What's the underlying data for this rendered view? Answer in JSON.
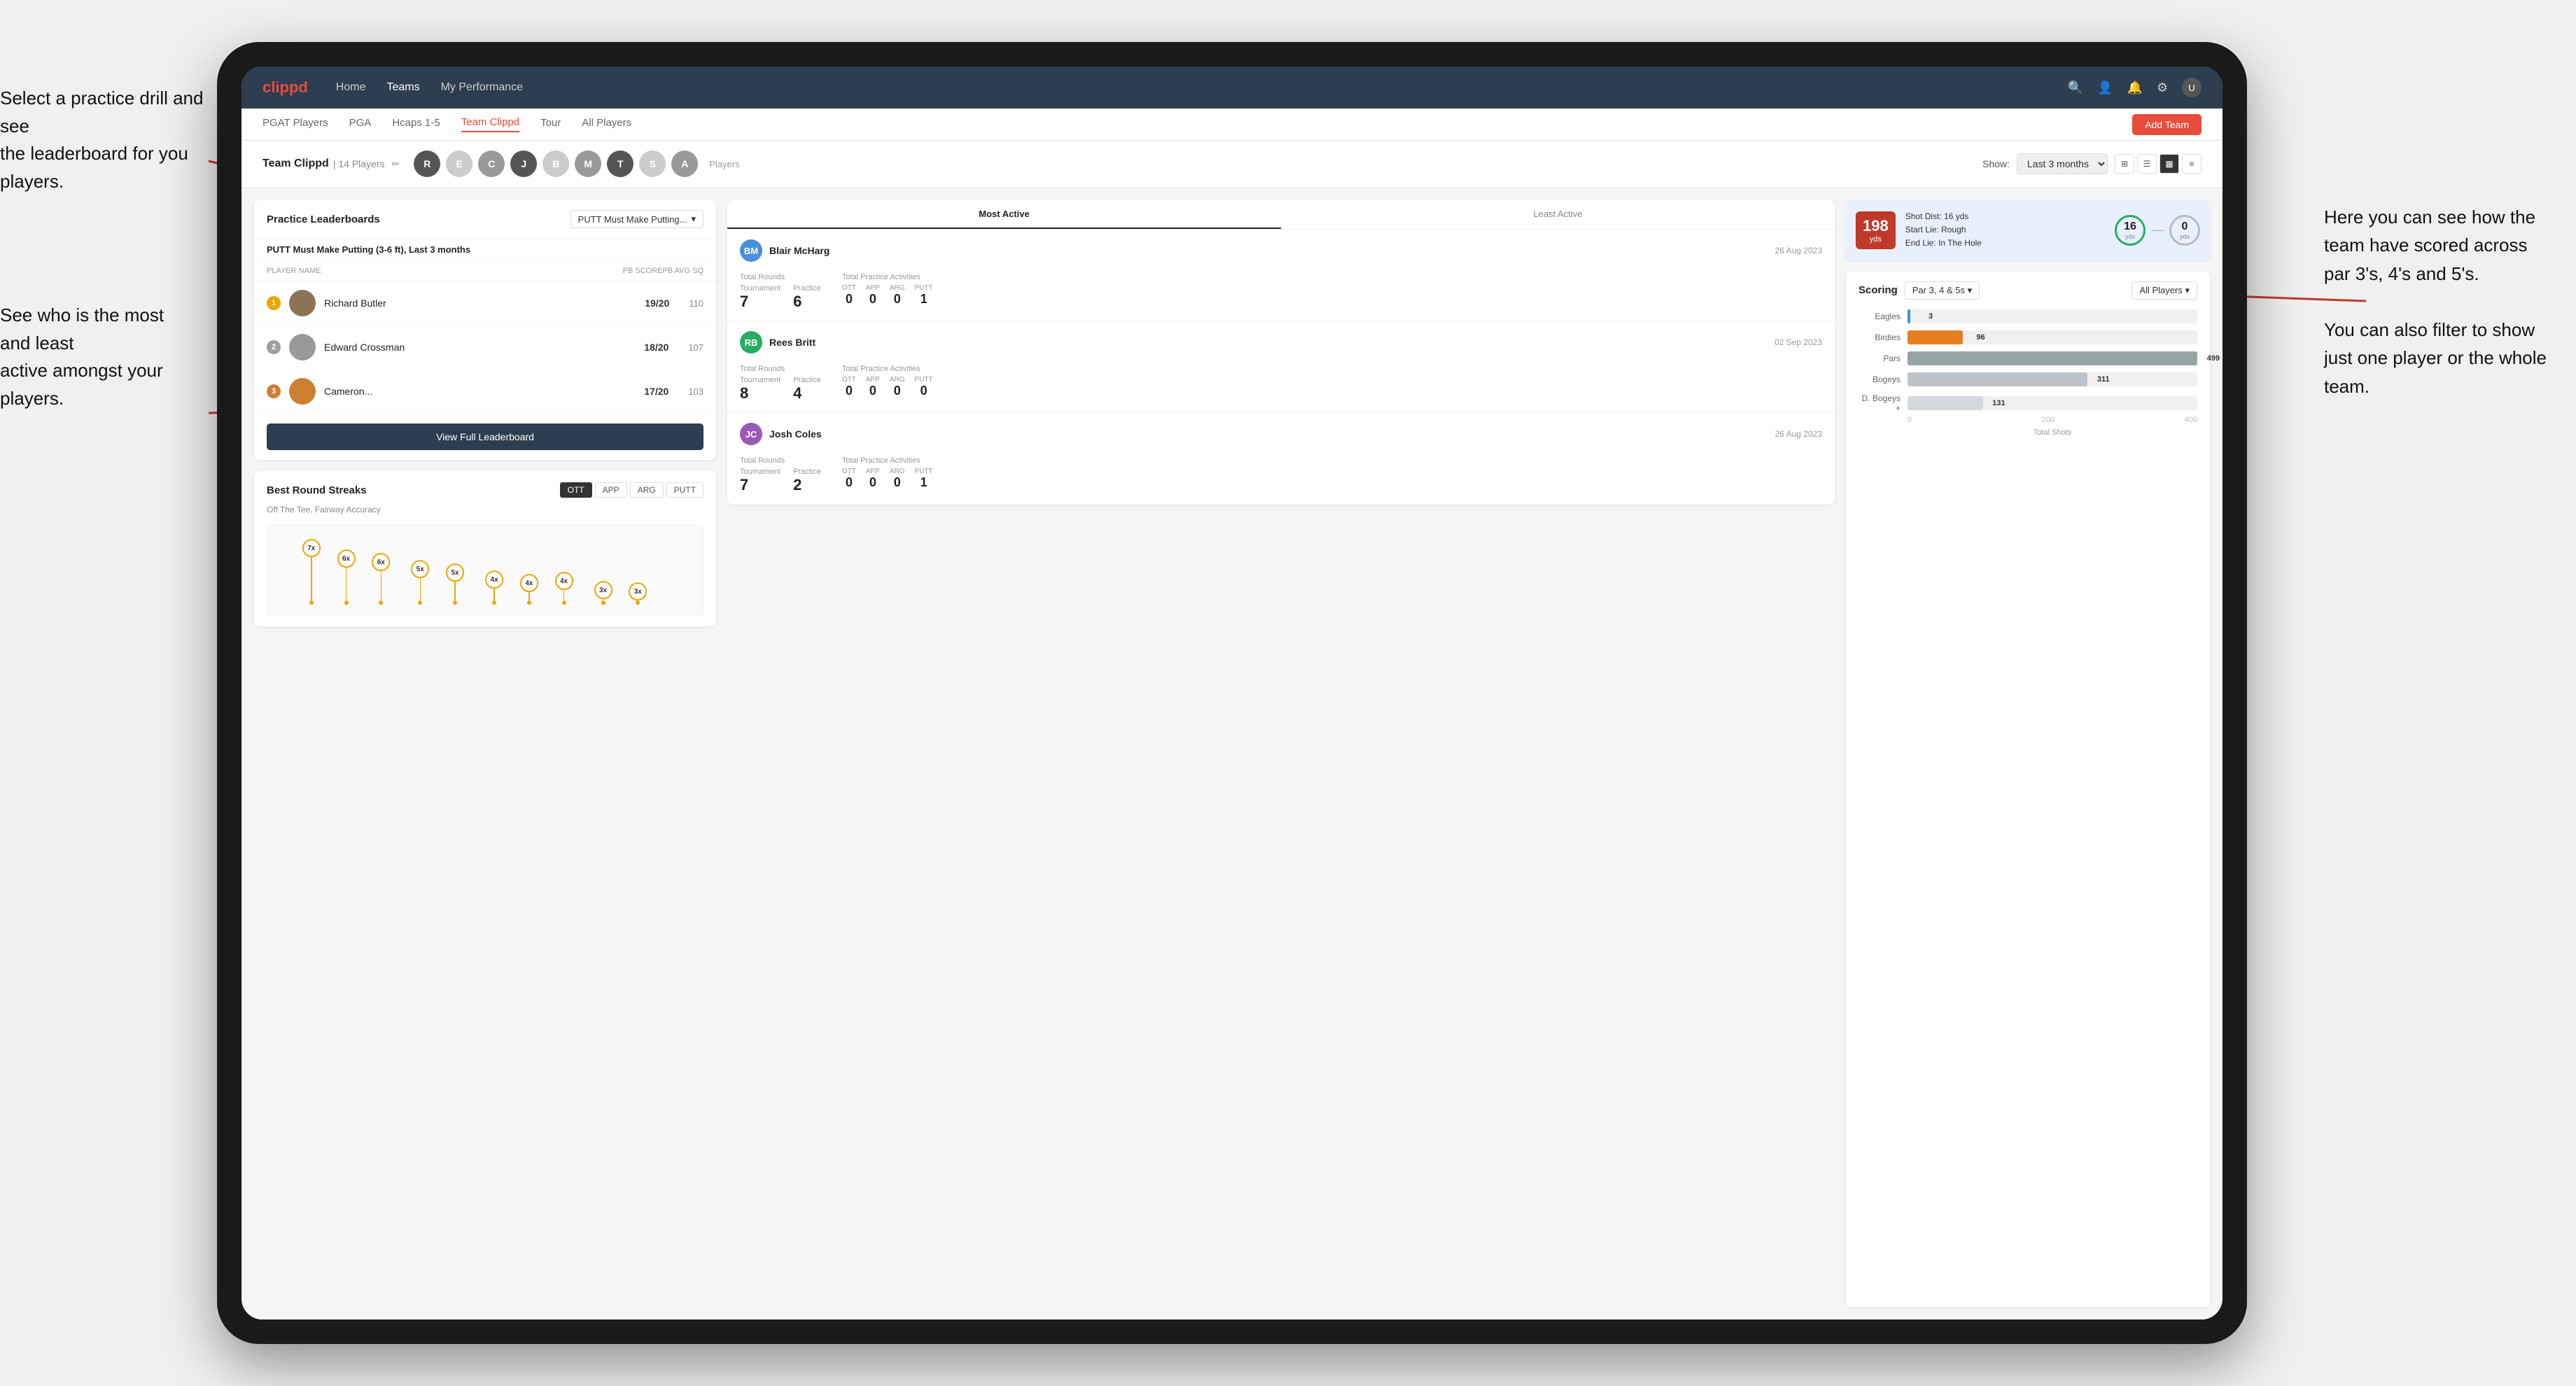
{
  "annotations": {
    "top_left": "Select a practice drill and see\nthe leaderboard for you players.",
    "bottom_left": "See who is the most and least\nactive amongst your players.",
    "right": "Here you can see how the\nteam have scored across\npar 3's, 4's and 5's.\n\nYou can also filter to show\njust one player or the whole\nteam."
  },
  "nav": {
    "logo": "clippd",
    "items": [
      "Home",
      "Teams",
      "My Performance"
    ],
    "icons": [
      "search",
      "person",
      "bell",
      "settings",
      "avatar"
    ]
  },
  "subnav": {
    "items": [
      "PGAT Players",
      "PGA",
      "Hcaps 1-5",
      "Team Clippd",
      "Tour",
      "All Players"
    ],
    "active": "Team Clippd",
    "add_team": "Add Team"
  },
  "team_header": {
    "title": "Team Clippd",
    "count": "14 Players",
    "show_label": "Show:",
    "show_value": "Last 3 months",
    "players_label": "Players"
  },
  "practice_leaderboards": {
    "title": "Practice Leaderboards",
    "drill_label": "PUTT Must Make Putting...",
    "drill_full": "PUTT Must Make Putting (3-6 ft),",
    "period": "Last 3 months",
    "col_player": "PLAYER NAME",
    "col_score": "PB SCORE",
    "col_sq": "PB AVG SQ",
    "players": [
      {
        "rank": 1,
        "name": "Richard Butler",
        "score": "19/20",
        "sq": "110",
        "medal": "gold"
      },
      {
        "rank": 2,
        "name": "Edward Crossman",
        "score": "18/20",
        "sq": "107",
        "medal": "silver"
      },
      {
        "rank": 3,
        "name": "Cameron...",
        "score": "17/20",
        "sq": "103",
        "medal": "bronze"
      }
    ],
    "view_full": "View Full Leaderboard"
  },
  "best_streaks": {
    "title": "Best Round Streaks",
    "subtitle": "Off The Tee, Fairway Accuracy",
    "filters": [
      "OTT",
      "APP",
      "ARG",
      "PUTT"
    ],
    "active_filter": "OTT",
    "pins": [
      {
        "x": 8,
        "label": "7x",
        "height": 90
      },
      {
        "x": 16,
        "label": "6x",
        "height": 75
      },
      {
        "x": 24,
        "label": "6x",
        "height": 70
      },
      {
        "x": 33,
        "label": "5x",
        "height": 60
      },
      {
        "x": 41,
        "label": "5x",
        "height": 55
      },
      {
        "x": 50,
        "label": "4x",
        "height": 45
      },
      {
        "x": 58,
        "label": "4x",
        "height": 40
      },
      {
        "x": 66,
        "label": "4x",
        "height": 43
      },
      {
        "x": 75,
        "label": "3x",
        "height": 30
      },
      {
        "x": 83,
        "label": "3x",
        "height": 28
      }
    ]
  },
  "activity": {
    "tabs": [
      "Most Active",
      "Least Active"
    ],
    "active_tab": "Most Active",
    "players": [
      {
        "name": "Blair McHarg",
        "date": "26 Aug 2023",
        "total_rounds_label": "Total Rounds",
        "tournament": "7",
        "tournament_label": "Tournament",
        "practice": "6",
        "practice_label": "Practice",
        "total_practice_label": "Total Practice Activities",
        "ott": "0",
        "app": "0",
        "arg": "0",
        "putt": "1"
      },
      {
        "name": "Rees Britt",
        "date": "02 Sep 2023",
        "total_rounds_label": "Total Rounds",
        "tournament": "8",
        "tournament_label": "Tournament",
        "practice": "4",
        "practice_label": "Practice",
        "total_practice_label": "Total Practice Activities",
        "ott": "0",
        "app": "0",
        "arg": "0",
        "putt": "0"
      },
      {
        "name": "Josh Coles",
        "date": "26 Aug 2023",
        "total_rounds_label": "Total Rounds",
        "tournament": "7",
        "tournament_label": "Tournament",
        "practice": "2",
        "practice_label": "Practice",
        "total_practice_label": "Total Practice Activities",
        "ott": "0",
        "app": "0",
        "arg": "0",
        "putt": "1"
      }
    ]
  },
  "shot": {
    "dist": "198",
    "unit": "yds",
    "dist_label": "Shot Dist: 16 yds",
    "start_lie": "Start Lie: Rough",
    "end_lie": "End Lie: In The Hole",
    "yds1": "16",
    "yds1_label": "yds",
    "yds2": "0",
    "yds2_label": "yds"
  },
  "scoring": {
    "title": "Scoring",
    "filter1": "Par 3, 4 & 5s",
    "filter2": "All Players",
    "bars": [
      {
        "label": "Eagles",
        "value": 3,
        "max": 500,
        "color": "eagles",
        "display": "3"
      },
      {
        "label": "Birdies",
        "value": 96,
        "max": 500,
        "color": "birdies",
        "display": "96"
      },
      {
        "label": "Pars",
        "value": 499,
        "max": 500,
        "color": "pars",
        "display": "499"
      },
      {
        "label": "Bogeys",
        "value": 311,
        "max": 500,
        "color": "bogeys",
        "display": "311"
      },
      {
        "label": "D. Bogeys +",
        "value": 131,
        "max": 500,
        "color": "dbogeys",
        "display": "131"
      }
    ],
    "axis_labels": [
      "0",
      "200",
      "400"
    ],
    "axis_footer": "Total Shots"
  }
}
